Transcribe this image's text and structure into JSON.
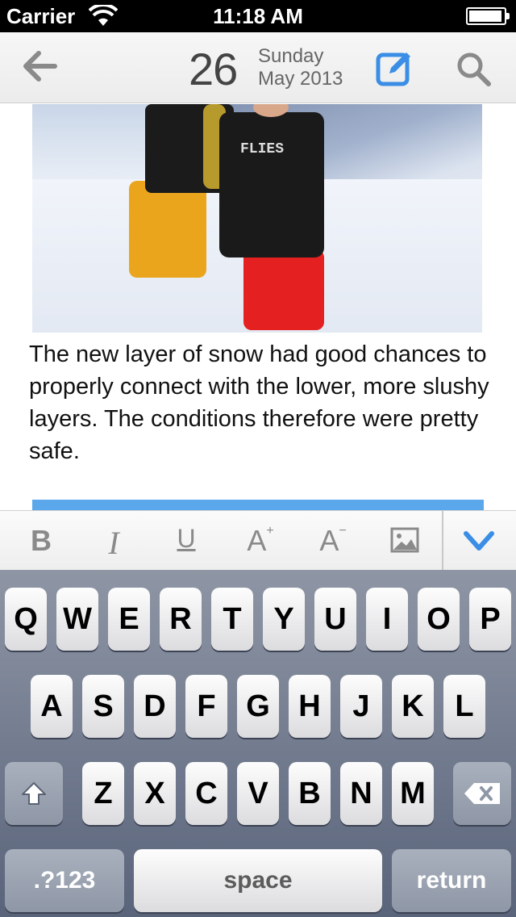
{
  "status_bar": {
    "carrier": "Carrier",
    "time": "11:18 AM"
  },
  "nav": {
    "day": "26",
    "weekday": "Sunday",
    "month_year": "May 2013"
  },
  "photo": {
    "shirt_text": "FLIES"
  },
  "entry": {
    "text": "The new layer of snow had good chances to properly connect with the lower, more slushy layers. The conditions therefore were pretty safe."
  },
  "format_toolbar": {
    "bold": "B",
    "italic": "I",
    "underline": "U",
    "font_larger": "A",
    "font_larger_mark": "+",
    "font_smaller": "A",
    "font_smaller_mark": "−"
  },
  "keyboard": {
    "row1": [
      "Q",
      "W",
      "E",
      "R",
      "T",
      "Y",
      "U",
      "I",
      "O",
      "P"
    ],
    "row2": [
      "A",
      "S",
      "D",
      "F",
      "G",
      "H",
      "J",
      "K",
      "L"
    ],
    "row3": [
      "Z",
      "X",
      "C",
      "V",
      "B",
      "N",
      "M"
    ],
    "numbers_key": ".?123",
    "space_key": "space",
    "return_key": "return"
  },
  "colors": {
    "accent_blue": "#3a8ee6",
    "icon_gray": "#8a8a8a"
  }
}
